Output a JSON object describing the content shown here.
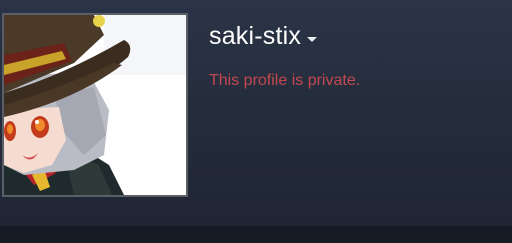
{
  "profile": {
    "persona_name": "saki-stix",
    "private_message": "This profile is private.",
    "avatar_icon": "avatar-anime-witch",
    "dropdown_icon": "caret-down-icon"
  },
  "colors": {
    "background": "#252d3d",
    "name": "#ffffff",
    "private_text": "#c4484f"
  }
}
